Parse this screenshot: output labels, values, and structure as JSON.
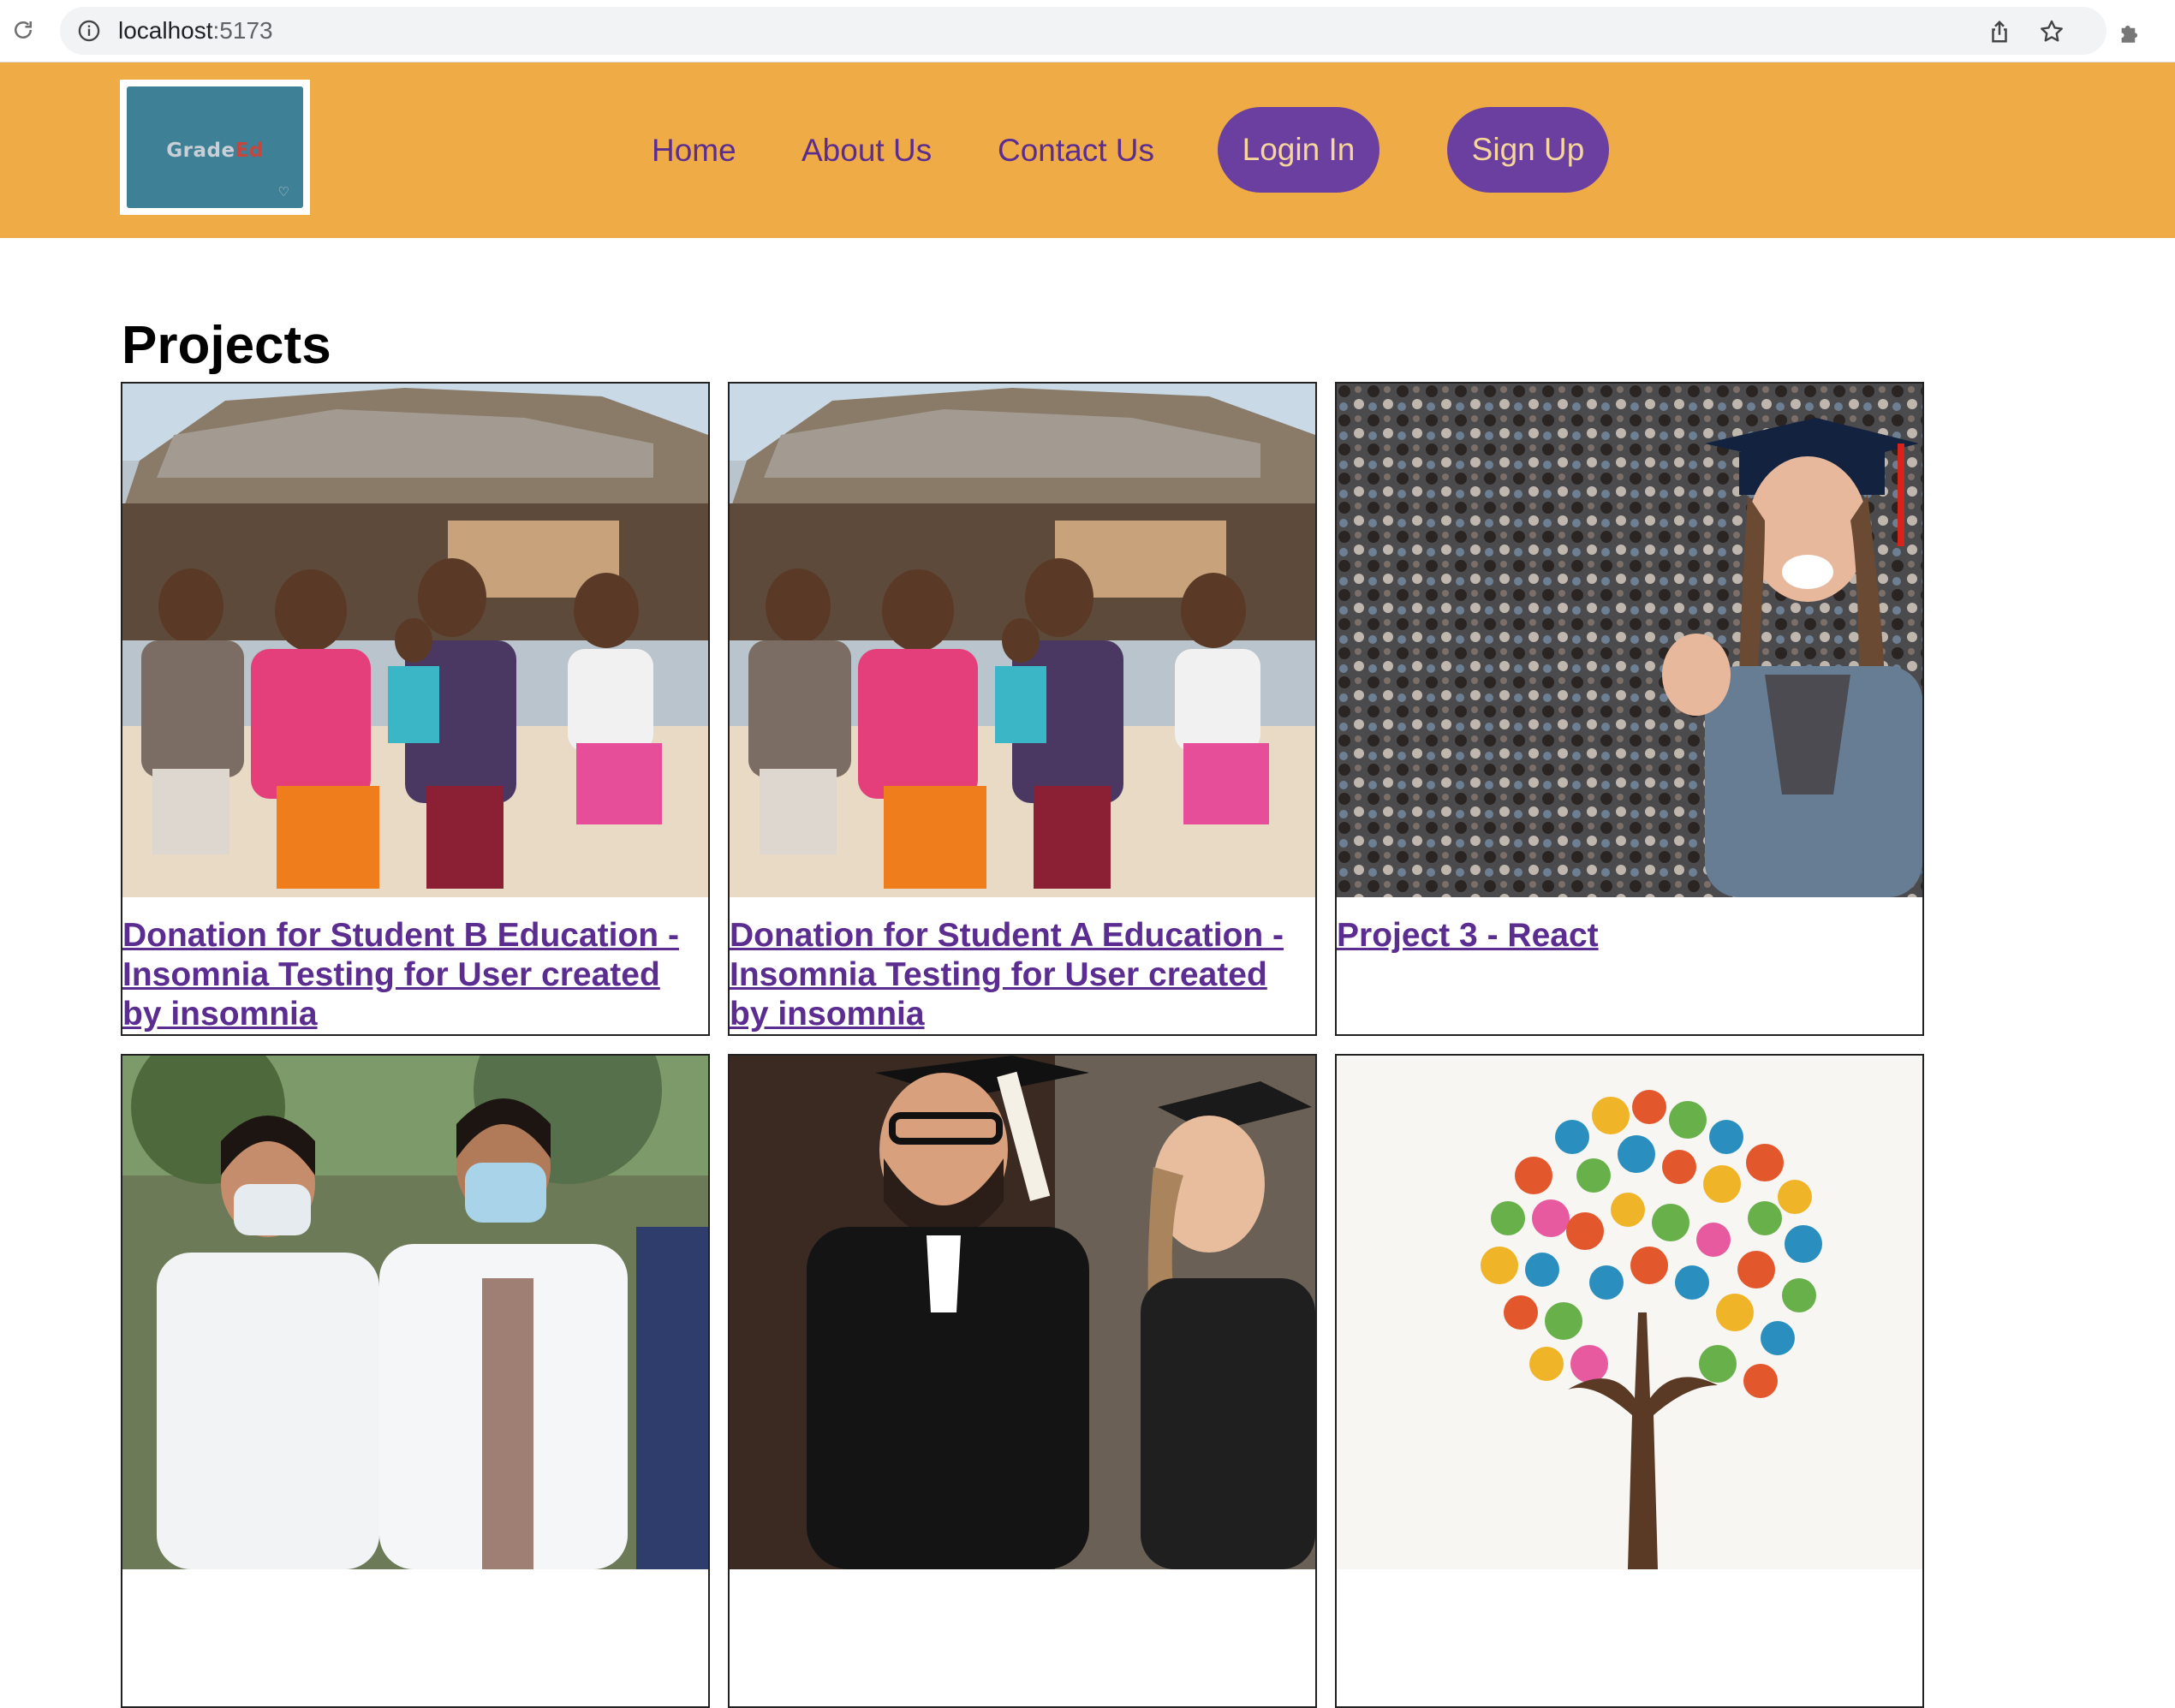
{
  "browser": {
    "url_host": "localhost",
    "url_port": ":5173"
  },
  "header": {
    "logo": {
      "text_primary": "Grade",
      "text_accent": "Ed"
    },
    "nav": {
      "home": "Home",
      "about": "About Us",
      "contact": "Contact Us"
    },
    "login_label": "Login In",
    "signup_label": "Sign Up"
  },
  "main": {
    "title": "Projects",
    "projects": [
      {
        "title": "Donation for Student B Education - Insomnia Testing for User created by insomnia",
        "image": "children-running-photo"
      },
      {
        "title": "Donation for Student A Education - Insomnia Testing for User created by insomnia",
        "image": "children-running-photo"
      },
      {
        "title": "Project 3 - React",
        "image": "graduate-in-crowd-photo"
      },
      {
        "title": "",
        "image": "medical-students-photo"
      },
      {
        "title": "",
        "image": "graduation-celebration-photo"
      },
      {
        "title": "",
        "image": "tree-of-hands-illustration"
      }
    ]
  },
  "colors": {
    "header_bg": "#efab45",
    "nav_text": "#5b2d91",
    "button_bg": "#6b3fa0",
    "button_text": "#f6d69a",
    "link": "#5b2d91",
    "logo_bg": "#3e8096"
  }
}
